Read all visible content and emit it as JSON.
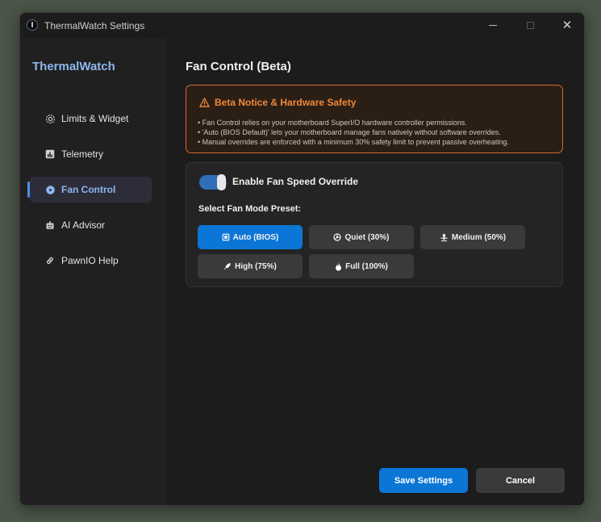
{
  "window": {
    "title": "ThermalWatch Settings"
  },
  "sidebar": {
    "brand": "ThermalWatch",
    "items": [
      {
        "label": "Limits & Widget",
        "icon": "gear-icon"
      },
      {
        "label": "Telemetry",
        "icon": "chart-icon"
      },
      {
        "label": "Fan Control",
        "icon": "fan-icon",
        "active": true
      },
      {
        "label": "AI Advisor",
        "icon": "robot-icon"
      },
      {
        "label": "PawnIO Help",
        "icon": "link-icon"
      }
    ]
  },
  "main": {
    "title": "Fan Control (Beta)",
    "notice": {
      "title": "Beta Notice & Hardware Safety",
      "lines": [
        "• Fan Control relies on your motherboard SuperI/O hardware controller permissions.",
        "• 'Auto (BIOS Default)' lets your motherboard manage fans natively without software overrides.",
        "• Manual overrides are enforced with a minimum 30% safety limit to prevent passive overheating."
      ]
    },
    "toggle": {
      "label": "Enable Fan Speed Override",
      "on": true
    },
    "preset_label": "Select Fan Mode Preset:",
    "presets": [
      {
        "label": "Auto (BIOS)",
        "icon": "chip-icon",
        "selected": true
      },
      {
        "label": "Quiet (30%)",
        "icon": "fan-icon"
      },
      {
        "label": "Medium (50%)",
        "icon": "wind-icon"
      },
      {
        "label": "High (75%)",
        "icon": "rocket-icon"
      },
      {
        "label": "Full (100%)",
        "icon": "flame-icon"
      }
    ]
  },
  "footer": {
    "save_label": "Save Settings",
    "cancel_label": "Cancel"
  },
  "colors": {
    "accent": "#0c76d6",
    "brand": "#8fb7ee",
    "warning": "#ef8a3c"
  }
}
